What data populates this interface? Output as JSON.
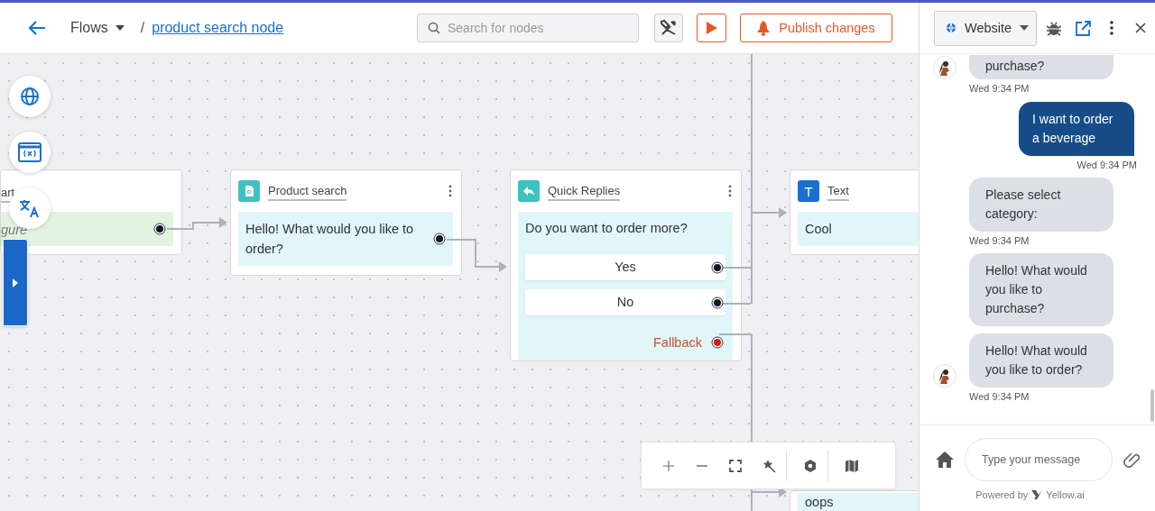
{
  "header": {
    "breadcrumb_root": "Flows",
    "separator": "/",
    "breadcrumb_current": "product search node",
    "search": {
      "placeholder": "Search for nodes"
    },
    "publish_button": "Publish changes"
  },
  "canvas": {
    "nodes": [
      {
        "kind": "start",
        "title": "art",
        "body": "gure"
      },
      {
        "kind": "product_search",
        "title": "Product search",
        "color": "#3cc2c0",
        "body": "Hello! What would you like to order?"
      },
      {
        "kind": "quick_replies",
        "title": "Quick Replies",
        "color": "#3cc2c0",
        "question": "Do you want to order more?",
        "options": [
          {
            "label": "Yes"
          },
          {
            "label": "No"
          }
        ],
        "fallback": "Fallback"
      },
      {
        "kind": "text",
        "title": "Text",
        "icon_text": "T",
        "color": "#1a6fd0",
        "body": "Cool"
      },
      {
        "kind": "partial",
        "body": "oops"
      }
    ]
  },
  "chat": {
    "channel": "Website",
    "messages": [
      {
        "kind": "bot",
        "text": "purchase?",
        "avatar": true,
        "time": "Wed 9:34 PM"
      },
      {
        "kind": "user",
        "text": "I want to order a beverage",
        "avatar": false,
        "time": "Wed 9:34 PM"
      },
      {
        "kind": "bot",
        "text": "Please select category:",
        "avatar": false,
        "time": "Wed 9:34 PM"
      },
      {
        "kind": "bot",
        "text": "Hello! What would you like to purchase?",
        "avatar": false
      },
      {
        "kind": "bot",
        "text": "Hello! What would you like to order?",
        "avatar": true,
        "time": "Wed 9:34 PM"
      }
    ],
    "input": {
      "placeholder": "Type your message"
    },
    "powered_by": "Powered by",
    "brand": "Yellow.ai"
  }
}
